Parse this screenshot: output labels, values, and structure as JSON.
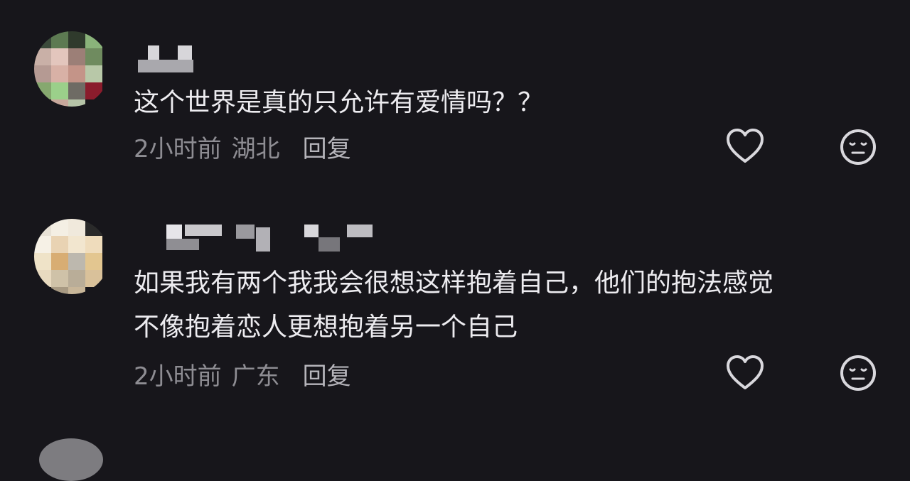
{
  "comments": [
    {
      "text_lines": [
        "这个世界是真的只允许有爱情吗？？"
      ],
      "time": "2小时前",
      "location": "湖北",
      "reply_label": "回复",
      "icons": [
        "heart-icon",
        "emoji-icon"
      ]
    },
    {
      "text_lines": [
        "如果我有两个我我会很想这样抱着自己，他们的抱法感觉",
        "不像抱着恋人更想抱着另一个自己"
      ],
      "time": "2小时前",
      "location": "广东",
      "reply_label": "回复",
      "icons": [
        "heart-icon",
        "emoji-icon"
      ]
    }
  ],
  "colors": {
    "background": "#17161b",
    "text": "#edecf0",
    "meta": "#8e8d93",
    "icon": "#d9d8dd"
  }
}
